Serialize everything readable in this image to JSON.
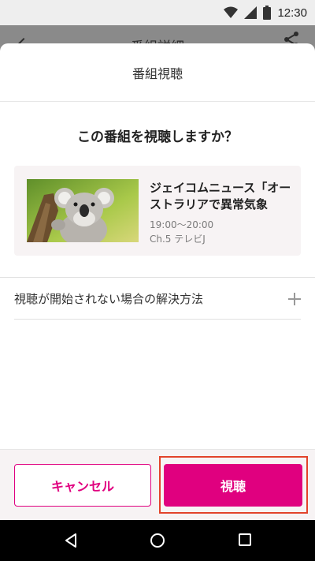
{
  "status_bar": {
    "time": "12:30"
  },
  "app_bar": {
    "title": "番組詳細"
  },
  "sheet": {
    "title": "番組視聴",
    "question": "この番組を視聴しますか？",
    "program": {
      "title": "ジェイコムニュース「オーストラリアで異常気象",
      "time": "19:00〜20:00",
      "channel": "Ch.5 テレビJ",
      "thumbnail_icon": "koala-image"
    },
    "help_label": "視聴が開始されない場合の解決方法"
  },
  "actions": {
    "cancel_label": "キャンセル",
    "watch_label": "視聴"
  },
  "colors": {
    "accent": "#e0007f",
    "highlight": "#e2432b"
  }
}
